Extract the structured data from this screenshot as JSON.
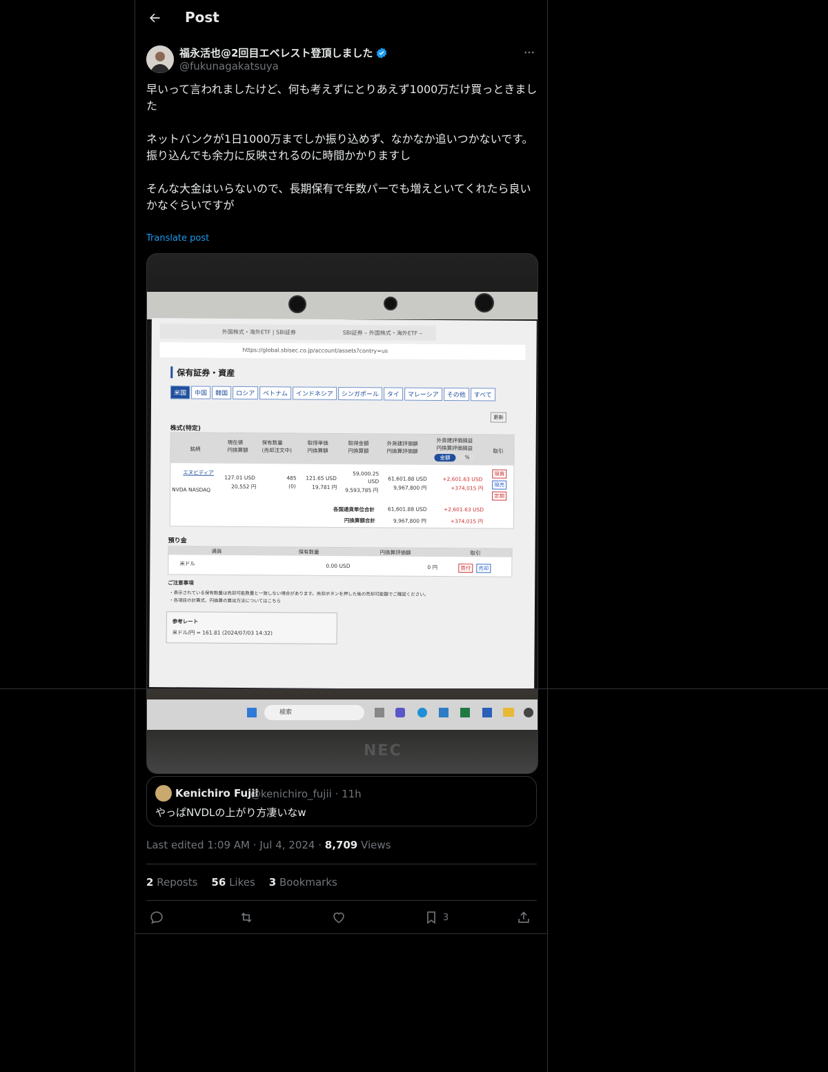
{
  "header": {
    "title": "Post"
  },
  "author": {
    "display_name": "福永活也@2回目エベレスト登頂しました",
    "handle": "@fukunagakatsuya"
  },
  "post": {
    "text": "早いって言われましたけど、何も考えずにとりあえず1000万だけ買っときました\n\nネットバンクが1日1000万までしか振り込めず、なかなか追いつかないです。\n振り込んでも余力に反映されるのに時間かかりますし\n\nそんな大金はいらないので、長期保有で年数パーでも増えといてくれたら良いかなぐらいですが",
    "translate_label": "Translate post"
  },
  "screenshot": {
    "tab1": "外国株式・海外ETF | SBI証券",
    "tab2": "SBI証券 – 外国株式・海外ETF –",
    "url": "https://global.sbisec.co.jp/account/assets?contry=us",
    "page_heading": "保有証券・資産",
    "country_tabs": [
      "米国",
      "中国",
      "韓国",
      "ロシア",
      "ベトナム",
      "インドネシア",
      "シンガポール",
      "タイ",
      "マレーシア",
      "その他",
      "すべて"
    ],
    "refresh_label": "更新",
    "stocks_label": "株式(特定)",
    "columns": [
      "銘柄",
      "現在値\n円換算額",
      "保有数量\n(売却注文中)",
      "取得単価\n円換算額",
      "取得金額\n円換算額",
      "外貨建評価額\n円換算評価額",
      "外貨建評価損益\n円換算評価損益",
      "取引"
    ],
    "toggle_amount": "金額",
    "toggle_percent": "%",
    "row": {
      "name": "エヌビディア",
      "ticker": "NVDA NASDAQ",
      "price_usd": "127.01 USD",
      "price_jpy": "20,552 円",
      "qty": "485",
      "qty_pending": "(0)",
      "cost_usd": "121.65 USD",
      "cost_jpy": "19,781 円",
      "amount_usd": "59,000.25 USD",
      "amount_jpy": "9,593,785 円",
      "value_usd": "61,601.88 USD",
      "value_jpy": "9,967,800 円",
      "pl_usd": "+2,601.63 USD",
      "pl_jpy": "+374,015 円",
      "actions": [
        "現買",
        "現売",
        "定期"
      ]
    },
    "subtotal_fx_label": "各国通貨単位合計",
    "subtotal_fx_value": "61,601.88 USD",
    "subtotal_fx_pl": "+2,601.63 USD",
    "subtotal_jpy_label": "円換算額合計",
    "subtotal_jpy_value": "9,967,800 円",
    "subtotal_jpy_pl": "+374,015 円",
    "deposit_label": "預り金",
    "deposit_columns": [
      "通貨",
      "保有数量",
      "円換算評価額",
      "取引"
    ],
    "deposit_currency": "米ドル",
    "deposit_qty": "0.00 USD",
    "deposit_value": "0 円",
    "deposit_actions": [
      "買付",
      "売却"
    ],
    "notes_title": "ご注意事項",
    "note1": "・表示されている保有数量は売却可能数量と一致しない場合があります。売却ボタンを押した後の売却可能額でご確認ください。",
    "note2": "・各項目の計算式、円換算の算出方法についてはこちら",
    "rate_title": "参考レート",
    "rate_value": "米ドル/円 = 161.81 (2024/07/03 14:32)",
    "taskbar_search": "検索",
    "laptop_brand": "NEC"
  },
  "quote": {
    "display_name": "Kenichiro Fujii",
    "handle_time": "@kenichiro_fujii · 11h",
    "text": "やっぱNVDLの上がり方凄いなw"
  },
  "meta": {
    "edited": "Last edited 1:09 AM",
    "date": "Jul 4, 2024",
    "views_count": "8,709",
    "views_label": "Views"
  },
  "stats": {
    "reposts_count": "2",
    "reposts_label": "Reposts",
    "likes_count": "56",
    "likes_label": "Likes",
    "bookmarks_count": "3",
    "bookmarks_label": "Bookmarks"
  },
  "actions": {
    "bookmark_count": "3"
  },
  "colors": {
    "accent": "#1d9bf0",
    "background": "#000000",
    "border": "#2f3336",
    "muted": "#71767b"
  }
}
